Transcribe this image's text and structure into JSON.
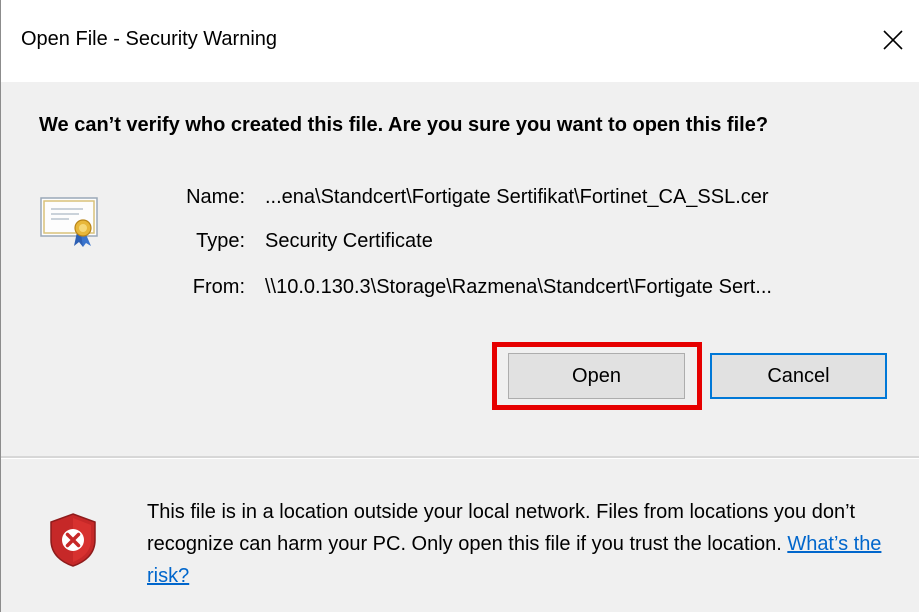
{
  "window": {
    "title": "Open File - Security Warning"
  },
  "main": {
    "heading": "We can’t verify who created this file. Are you sure you want to open this file?",
    "fields": [
      {
        "label": "Name:",
        "value": "...ena\\Standcert\\Fortigate Sertifikat\\Fortinet_CA_SSL.cer"
      },
      {
        "label": "Type:",
        "value": "Security Certificate"
      },
      {
        "label": "From:",
        "value": "\\\\10.0.130.3\\Storage\\Razmena\\Standcert\\Fortigate Sert..."
      }
    ],
    "buttons": {
      "open_label": "Open",
      "cancel_label": "Cancel"
    }
  },
  "footer": {
    "warning_text": "This file is in a location outside your local network. Files from locations you don’t recognize can harm your PC. Only open this file if you trust the location. ",
    "risk_link": "What’s the risk?"
  },
  "icons": {
    "close": "close-icon",
    "certificate": "certificate-icon",
    "shield": "shield-error-icon"
  },
  "colors": {
    "highlight": "#e60000",
    "link": "#0066cc",
    "focus_border": "#0078d7",
    "shield_red": "#d32f2f"
  }
}
